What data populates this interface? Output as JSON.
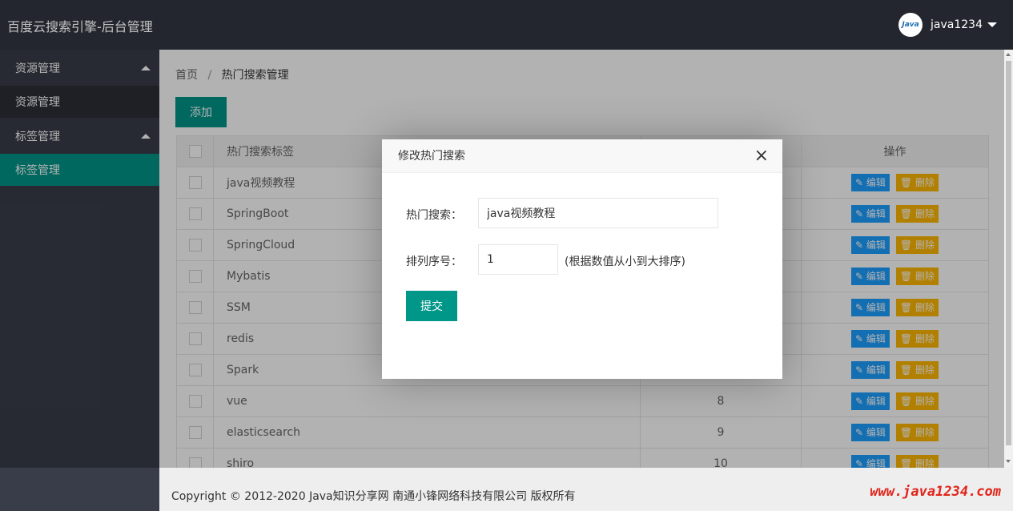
{
  "header": {
    "brand": "百度云搜索引擎-后台管理",
    "avatar_text": "Java",
    "username": "java1234"
  },
  "sidebar": {
    "groups": [
      {
        "label": "资源管理",
        "children": [
          {
            "label": "资源管理",
            "active": false
          }
        ]
      },
      {
        "label": "标签管理",
        "children": [
          {
            "label": "标签管理",
            "active": true
          }
        ]
      }
    ]
  },
  "breadcrumb": {
    "home": "首页",
    "separator": "/",
    "current": "热门搜索管理"
  },
  "toolbar": {
    "add_label": "添加"
  },
  "table": {
    "columns": [
      "热门搜索标签",
      "操作"
    ],
    "edit_label": "✎ 编辑",
    "delete_label": "🗑 删除",
    "rows": [
      {
        "name": "java视频教程",
        "order": ""
      },
      {
        "name": "SpringBoot",
        "order": ""
      },
      {
        "name": "SpringCloud",
        "order": ""
      },
      {
        "name": "Mybatis",
        "order": ""
      },
      {
        "name": "SSM",
        "order": ""
      },
      {
        "name": "redis",
        "order": ""
      },
      {
        "name": "Spark",
        "order": ""
      },
      {
        "name": "vue",
        "order": "8"
      },
      {
        "name": "elasticsearch",
        "order": "9"
      },
      {
        "name": "shiro",
        "order": "10"
      }
    ]
  },
  "modal": {
    "title": "修改热门搜索",
    "close": "×",
    "fields": {
      "keyword_label": "热门搜索：",
      "keyword_value": "java视频教程",
      "order_label": "排列序号：",
      "order_value": "1",
      "order_hint": "(根据数值从小到大排序)"
    },
    "submit_label": "提交"
  },
  "footer": {
    "copyright": "Copyright © 2012-2020 Java知识分享网 南通小锋网络科技有限公司 版权所有",
    "watermark": "www.java1234.com"
  },
  "colors": {
    "primary": "#009688",
    "header": "#23262e",
    "sidebar": "#393d49",
    "edit": "#1e9fff",
    "delete": "#ffb800"
  }
}
